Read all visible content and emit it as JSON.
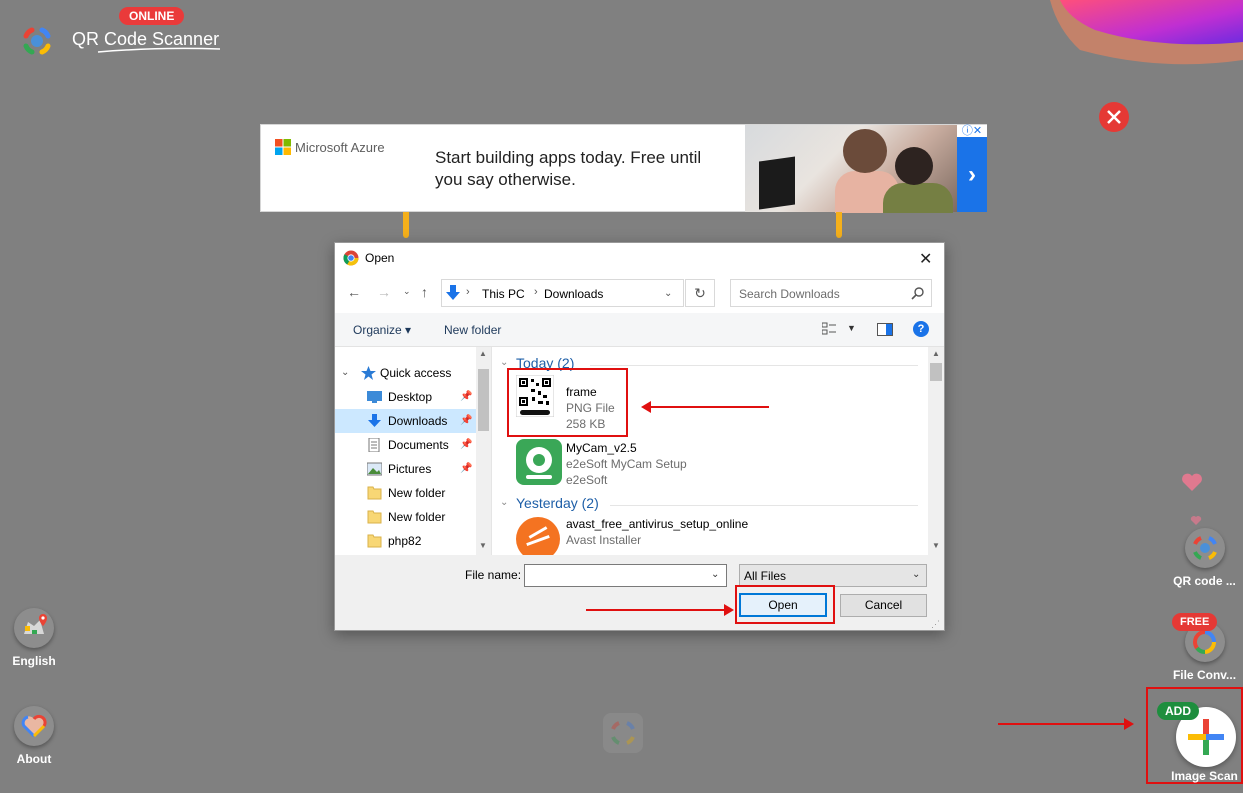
{
  "app": {
    "title": "QR Code Scanner",
    "badge": "ONLINE"
  },
  "ad": {
    "brand": "Microsoft Azure",
    "headline": "Start building apps today. Free until you say otherwise.",
    "next_glyph": "›",
    "info_glyph": "ⓘ✕"
  },
  "dialog": {
    "title": "Open",
    "breadcrumb": [
      "This PC",
      "Downloads"
    ],
    "search_placeholder": "Search Downloads",
    "toolbar": {
      "organize": "Organize ▾",
      "new_folder": "New folder"
    },
    "nav_tree": [
      {
        "label": "Quick access",
        "icon": "star-icon"
      },
      {
        "label": "Desktop",
        "icon": "desktop-icon",
        "pinned": true
      },
      {
        "label": "Downloads",
        "icon": "download-icon",
        "pinned": true,
        "selected": true
      },
      {
        "label": "Documents",
        "icon": "document-icon",
        "pinned": true
      },
      {
        "label": "Pictures",
        "icon": "picture-icon",
        "pinned": true
      },
      {
        "label": "New folder",
        "icon": "folder-icon"
      },
      {
        "label": "New folder",
        "icon": "folder-icon"
      },
      {
        "label": "php82",
        "icon": "folder-icon"
      }
    ],
    "groups": [
      {
        "heading": "Today (2)",
        "files": [
          {
            "name": "frame",
            "type": "PNG File",
            "detail": "258 KB",
            "icon": "qr-thumbnail-icon"
          },
          {
            "name": "MyCam_v2.5",
            "type": "e2eSoft MyCam Setup",
            "detail": "e2eSoft",
            "icon": "mycam-app-icon"
          }
        ]
      },
      {
        "heading": "Yesterday (2)",
        "files": [
          {
            "name": "avast_free_antivirus_setup_online",
            "type": "Avast Installer",
            "icon": "avast-app-icon"
          }
        ]
      }
    ],
    "file_name_label": "File name:",
    "file_name_value": "",
    "file_type": "All Files",
    "open_label": "Open",
    "cancel_label": "Cancel"
  },
  "side": {
    "english": "English",
    "about": "About",
    "qr_code": "QR code ...",
    "file_conv": "File Conv...",
    "free_badge": "FREE",
    "add_badge": "ADD",
    "image_scan": "Image Scan"
  },
  "colors": {
    "background": "#808080",
    "accent_red": "#e01010",
    "selection": "#cce8ff",
    "button_blue": "#0078d7"
  }
}
